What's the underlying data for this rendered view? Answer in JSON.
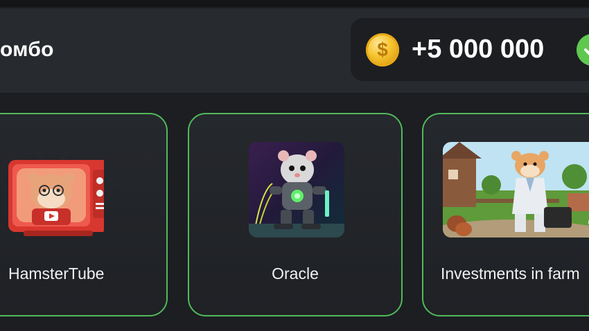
{
  "combo": {
    "title": "омбо",
    "reward_amount": "+5 000 000",
    "coin_icon": "coin-icon",
    "coin_symbol": "$",
    "status_icon": "check-icon"
  },
  "cards": [
    {
      "label": "HamsterTube",
      "image": "hamster-tv-icon"
    },
    {
      "label": "Oracle",
      "image": "robot-hamster-icon"
    },
    {
      "label": "Investments in farm",
      "image": "farm-hamster-icon"
    }
  ],
  "colors": {
    "accent_border": "#52b95a",
    "check_green": "#5fc84f",
    "coin_gold": "#f7c531",
    "background": "#1c1e22"
  }
}
